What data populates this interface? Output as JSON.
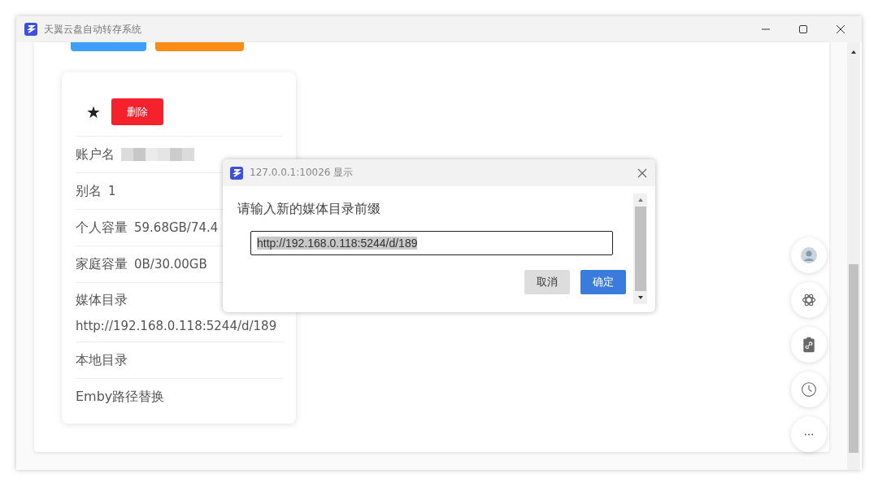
{
  "window": {
    "title": "天翼云盘自动转存系统"
  },
  "top_buttons": [
    {
      "color": "#409eff"
    },
    {
      "color": "#fa8c16"
    }
  ],
  "account_card": {
    "star": "★",
    "delete_button": "删除",
    "fields": [
      {
        "kind": "redacted",
        "label": "账户名"
      },
      {
        "kind": "inline",
        "label": "别名",
        "value": "1"
      },
      {
        "kind": "inline",
        "label": "个人容量",
        "value": "59.68GB/74.4"
      },
      {
        "kind": "inline",
        "label": "家庭容量",
        "value": "0B/30.00GB"
      },
      {
        "kind": "stacked",
        "label": "媒体目录",
        "value": "http://192.168.0.118:5244/d/189"
      },
      {
        "kind": "inline",
        "label": "本地目录"
      },
      {
        "kind": "inline",
        "label": "Emby路径替换"
      }
    ]
  },
  "dialog": {
    "title": "127.0.0.1:10026 显示",
    "message": "请输入新的媒体目录前缀",
    "input_value": "http://192.168.0.118:5244/d/189",
    "buttons": [
      {
        "label": "取消",
        "kind": "secondary"
      },
      {
        "label": "确定",
        "kind": "primary"
      }
    ]
  }
}
